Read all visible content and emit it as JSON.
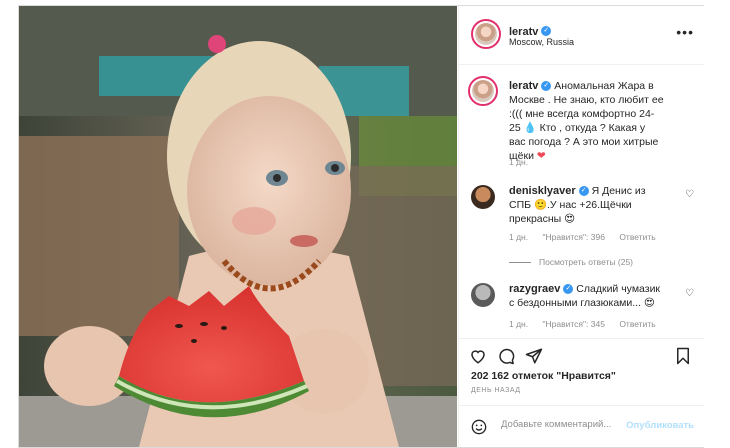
{
  "post": {
    "username": "leratv",
    "location": "Moscow, Russia",
    "caption": "Аномальная Жара в Москве . Не знаю, кто любит ее :((( мне всегда комфортно 24-25 💧 Кто , откуда ? Какая у вас погода ? А это мои хитрые щёки",
    "caption_age": "1 дн."
  },
  "comments": [
    {
      "username": "denisklyaver",
      "text": "Я Денис из СПБ 🙂.У нас +26.Щёчки прекрасны 😍",
      "age": "1 дн.",
      "likes": "\"Нравится\": 396",
      "reply_label": "Ответить",
      "view_replies": "Посмотреть ответы (25)"
    },
    {
      "username": "razygraev",
      "text": "Сладкий чумазик с бездонными глазюками... 😍",
      "age": "1 дн.",
      "likes": "\"Нравится\": 345",
      "reply_label": "Ответить"
    }
  ],
  "likes_summary": "202 162 отметок \"Нравится\"",
  "date_label": "ДЕНЬ НАЗАД",
  "composer": {
    "placeholder": "Добавьте комментарий...",
    "publish_label": "Опубликовать"
  },
  "icons": {
    "more": "more-options-icon",
    "like": "heart-icon",
    "comment": "comment-icon",
    "share": "send-icon",
    "save": "bookmark-icon",
    "emoji": "emoji-icon",
    "verified": "verified-badge-icon"
  },
  "colors": {
    "verified": "#3897f0",
    "heart": "#ed4956",
    "publish_disabled": "#b2dffc",
    "muted": "#8e8e8e"
  }
}
